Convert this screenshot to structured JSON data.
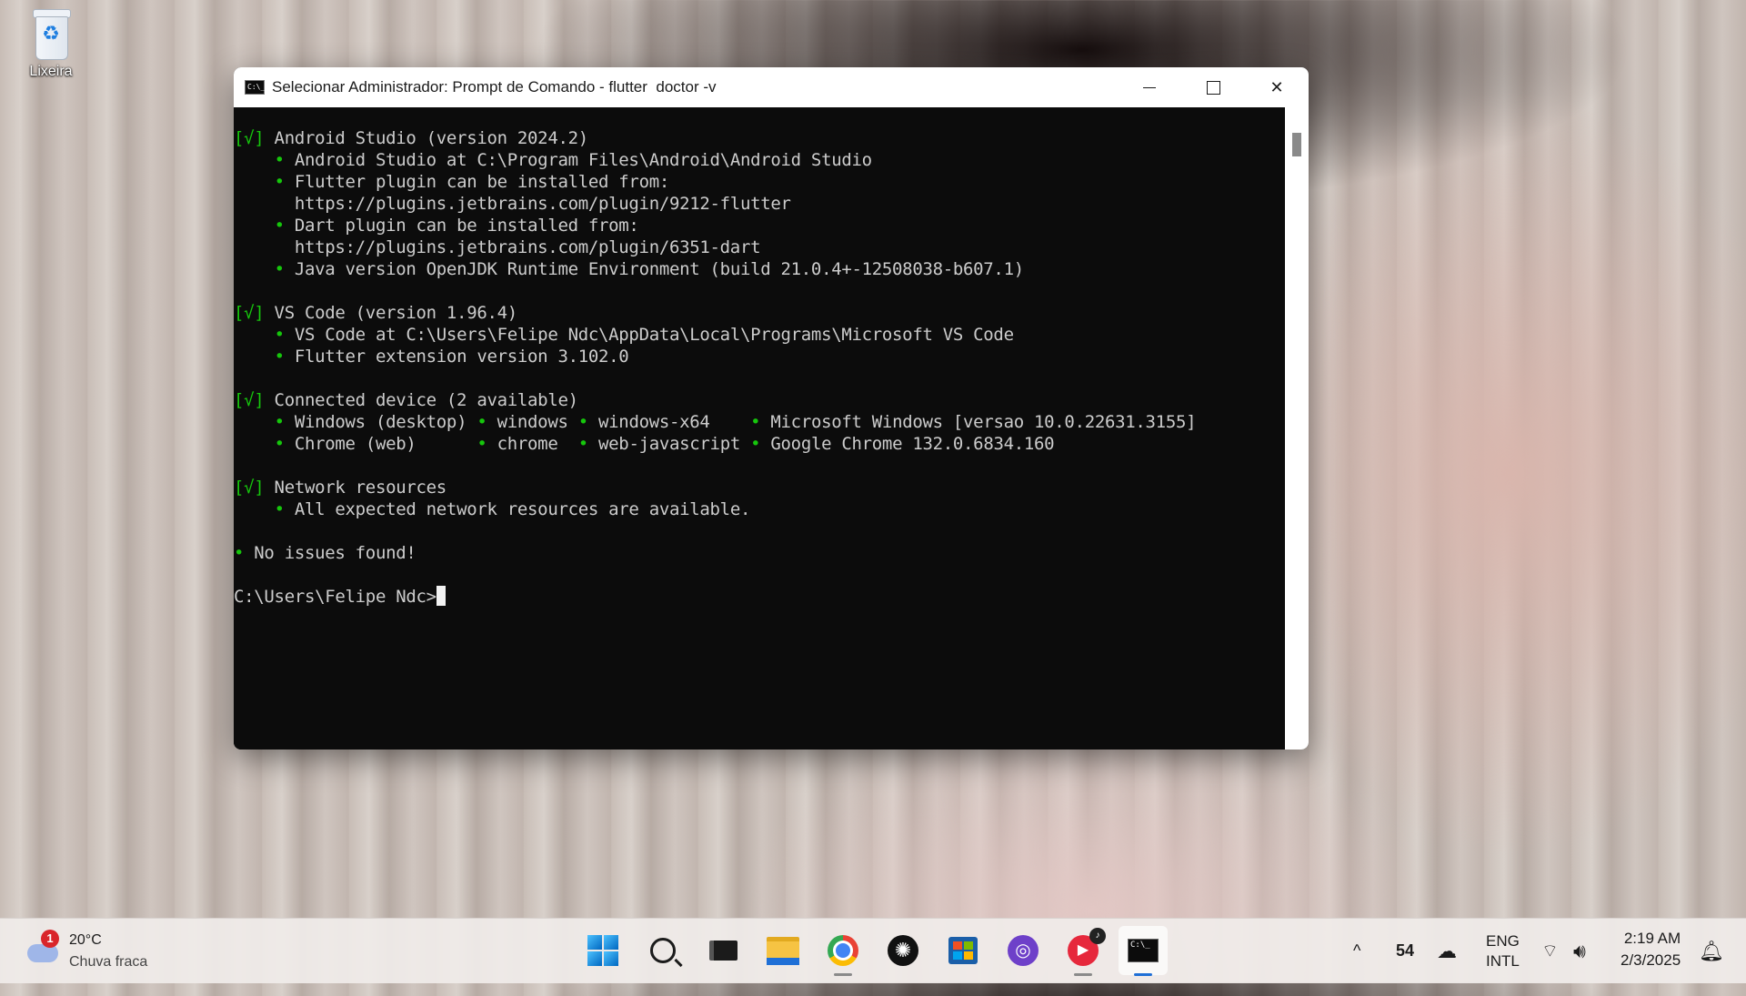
{
  "desktop": {
    "recycle_bin_label": "Lixeira"
  },
  "window": {
    "title": "Selecionar Administrador: Prompt de Comando - flutter  doctor -v",
    "app_icon_text": "C:\\_",
    "controls": {
      "minimize": "—",
      "close": "✕"
    }
  },
  "terminal": {
    "lines": [
      {
        "mark": "[√]",
        "text": " Android Studio (version 2024.2)"
      },
      {
        "mark": "",
        "text": "    • Android Studio at C:\\Program Files\\Android\\Android Studio"
      },
      {
        "mark": "",
        "text": "    • Flutter plugin can be installed from:"
      },
      {
        "mark": "",
        "text": "      https://plugins.jetbrains.com/plugin/9212-flutter"
      },
      {
        "mark": "",
        "text": "    • Dart plugin can be installed from:"
      },
      {
        "mark": "",
        "text": "      https://plugins.jetbrains.com/plugin/6351-dart"
      },
      {
        "mark": "",
        "text": "    • Java version OpenJDK Runtime Environment (build 21.0.4+-12508038-b607.1)"
      },
      {
        "mark": "",
        "text": ""
      },
      {
        "mark": "[√]",
        "text": " VS Code (version 1.96.4)"
      },
      {
        "mark": "",
        "text": "    • VS Code at C:\\Users\\Felipe Ndc\\AppData\\Local\\Programs\\Microsoft VS Code"
      },
      {
        "mark": "",
        "text": "    • Flutter extension version 3.102.0"
      },
      {
        "mark": "",
        "text": ""
      },
      {
        "mark": "[√]",
        "text": " Connected device (2 available)"
      },
      {
        "mark": "",
        "text": "    • Windows (desktop) • windows • windows-x64    • Microsoft Windows [versao 10.0.22631.3155]"
      },
      {
        "mark": "",
        "text": "    • Chrome (web)      • chrome  • web-javascript • Google Chrome 132.0.6834.160"
      },
      {
        "mark": "",
        "text": ""
      },
      {
        "mark": "[√]",
        "text": " Network resources"
      },
      {
        "mark": "",
        "text": "    • All expected network resources are available."
      },
      {
        "mark": "",
        "text": ""
      },
      {
        "mark": "•",
        "text": " No issues found!"
      },
      {
        "mark": "",
        "text": ""
      }
    ],
    "prompt": "C:\\Users\\Felipe Ndc>"
  },
  "taskbar": {
    "weather": {
      "badge": "1",
      "temp": "20°C",
      "condition": "Chuva fraca"
    },
    "apps": [
      {
        "name": "start",
        "icon": "windows-logo-icon"
      },
      {
        "name": "search",
        "icon": "search-icon"
      },
      {
        "name": "task-view",
        "icon": "task-view-icon"
      },
      {
        "name": "file-explorer",
        "icon": "folder-icon"
      },
      {
        "name": "chrome",
        "icon": "chrome-icon"
      },
      {
        "name": "chatgpt",
        "icon": "chatgpt-icon"
      },
      {
        "name": "microsoft-store",
        "icon": "store-icon"
      },
      {
        "name": "github-desktop",
        "icon": "github-icon"
      },
      {
        "name": "media-player",
        "icon": "play-icon"
      },
      {
        "name": "command-prompt",
        "icon": "cmd-icon",
        "active": true
      }
    ],
    "tray": {
      "chevron": "^",
      "number": "54",
      "lang_top": "ENG",
      "lang_bottom": "INTL",
      "time": "2:19 AM",
      "date": "2/3/2025"
    }
  },
  "colors": {
    "terminal_bg": "#0c0c0c",
    "terminal_fg": "#cccccc",
    "ok_green": "#16c60c",
    "accent": "#1f6fd6"
  }
}
